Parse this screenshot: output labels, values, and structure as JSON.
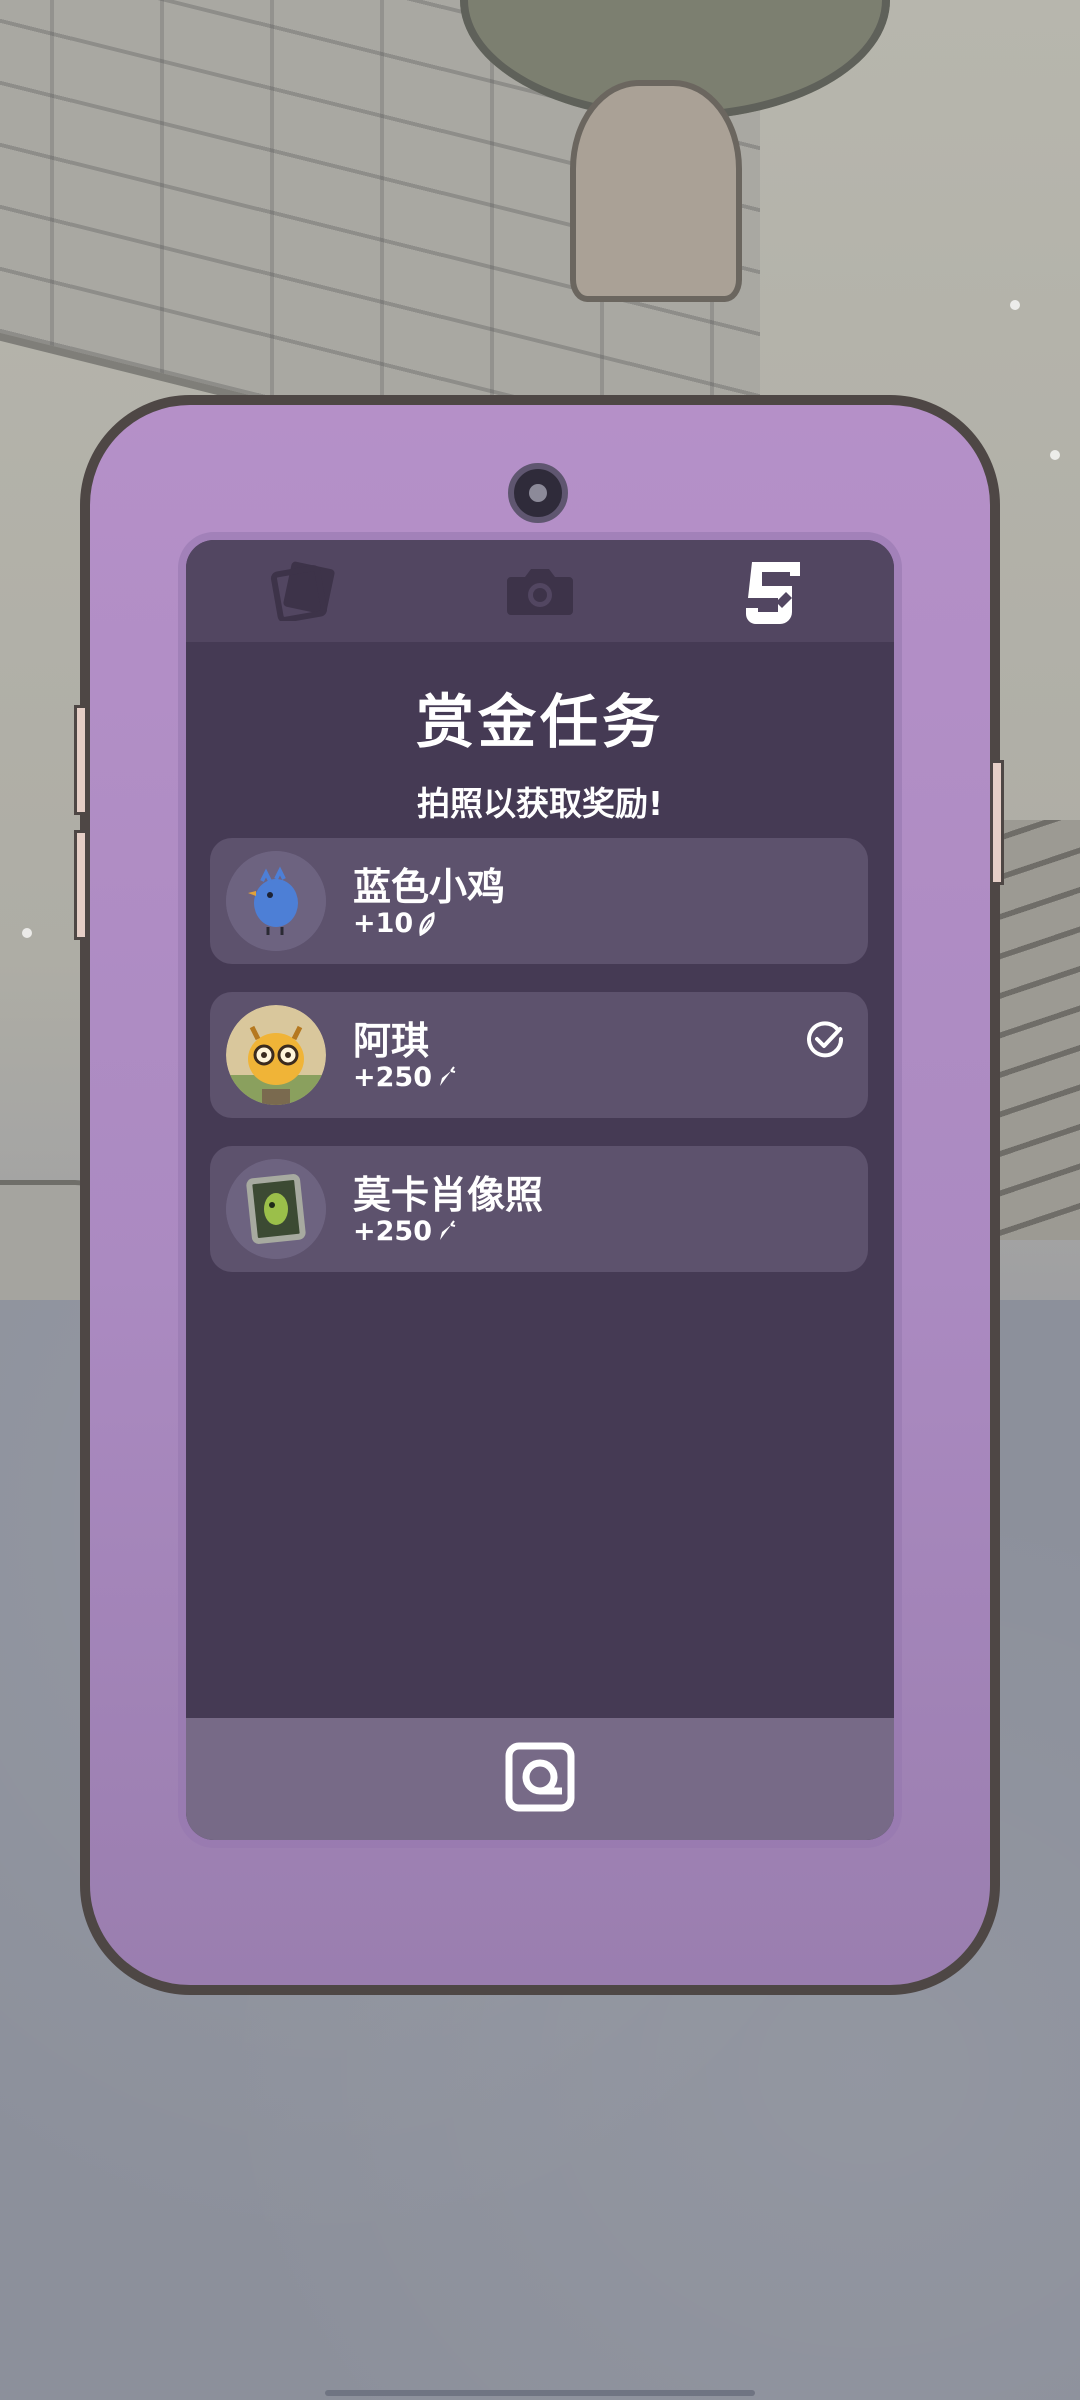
{
  "bounty": {
    "title": "赏金任务",
    "subtitle": "拍照以获取奖励!",
    "items": [
      {
        "name": "蓝色小鸡",
        "reward": "+10",
        "reward_icon": "feather-icon",
        "completed": false,
        "avatar": "blue-chick"
      },
      {
        "name": "阿琪",
        "reward": "+250",
        "reward_icon": "carrot-icon",
        "completed": true,
        "avatar": "giraffe-aqi"
      },
      {
        "name": "莫卡肖像照",
        "reward": "+250",
        "reward_icon": "carrot-icon",
        "completed": false,
        "avatar": "portrait-frame"
      }
    ]
  },
  "tabs": [
    {
      "icon": "photo-album-icon",
      "active": false
    },
    {
      "icon": "camera-icon",
      "active": false
    },
    {
      "icon": "bounty-list-icon",
      "active": true
    }
  ],
  "colors": {
    "phone_body": "#b590c8",
    "phone_outline": "#4e4745",
    "screen_bg": "#453a54",
    "tab_bar": "#524661",
    "card_bg": "#5d526d",
    "bottom_bar": "#776a87",
    "text": "#ffffff"
  }
}
